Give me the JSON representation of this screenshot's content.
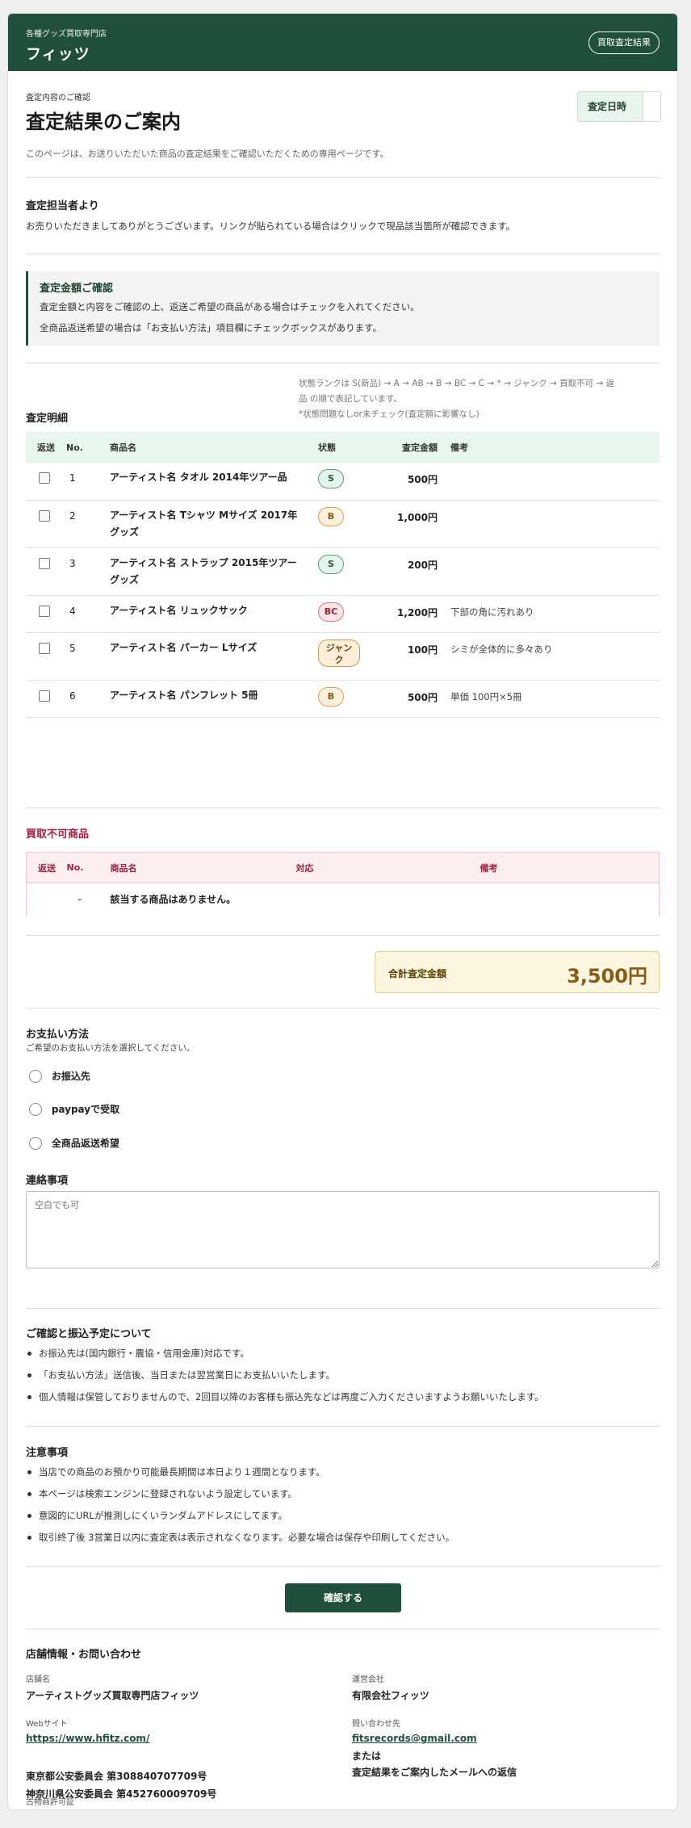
{
  "header": {
    "shop_sub": "各種グッズ買取専門店",
    "shop_name": "フィッツ",
    "result_button": "買取査定結果"
  },
  "intro": {
    "label": "査定内容のご確認",
    "title": "査定結果のご案内",
    "description": "このページは、お送りいただいた商品の査定結果をご確認いただくための専用ページです。",
    "date_label": "査定日時"
  },
  "appraiser": {
    "title": "査定担当者より",
    "message": "お売りいただきましてありがとうございます。リンクが貼られている場合はクリックで現品該当箇所が確認できます。"
  },
  "notice": {
    "title": "査定金額ご確認",
    "line1": "査定金額と内容をご確認の上、返送ご希望の商品がある場合はチェックを入れてください。",
    "line2": "全商品返送希望の場合は「お支払い方法」項目欄にチェックボックスがあります。"
  },
  "details": {
    "title": "査定明細",
    "rank_note1": "状態ランクは S(新品) → A → AB → B → BC → C → * → ジャンク → 買取不可 → 返",
    "rank_note2": "品 の順で表記しています。",
    "rank_note3": "*状態問題なしor未チェック(査定額に影響なし)",
    "columns": [
      "返送",
      "No.",
      "商品名",
      "状態",
      "査定金額",
      "備考"
    ],
    "rows": [
      {
        "no": "1",
        "name": "アーティスト名 タオル 2014年ツアー品",
        "name2": "",
        "status": "S",
        "price": "500円",
        "note": ""
      },
      {
        "no": "2",
        "name": "アーティスト名 Tシャツ Mサイズ 2017年",
        "name2": "グッズ",
        "status": "B",
        "price": "1,000円",
        "note": ""
      },
      {
        "no": "3",
        "name": "アーティスト名 ストラップ 2015年ツアー",
        "name2": "グッズ",
        "status": "S",
        "price": "200円",
        "note": ""
      },
      {
        "no": "4",
        "name": "アーティスト名 リュックサック",
        "name2": "",
        "status": "BC",
        "price": "1,200円",
        "note": "下部の角に汚れあり"
      },
      {
        "no": "5",
        "name": "アーティスト名 パーカー Lサイズ",
        "name2": "",
        "status": "ジャンク",
        "price": "100円",
        "note": "シミが全体的に多々あり"
      },
      {
        "no": "6",
        "name": "アーティスト名 パンフレット 5冊",
        "name2": "",
        "status": "B",
        "price": "500円",
        "note": "単価 100円×5冊"
      }
    ]
  },
  "rejected": {
    "title": "買取不可商品",
    "columns": [
      "返送",
      "No.",
      "商品名",
      "対応",
      "備考"
    ],
    "empty_no": "-",
    "empty_text": "該当する商品はありません。"
  },
  "total": {
    "label": "合計査定金額",
    "value": "3,500円"
  },
  "payment": {
    "title": "お支払い方法",
    "subtitle": "ご希望のお支払い方法を選択してください。",
    "options": [
      "お振込先",
      "paypayで受取",
      "全商品返送希望"
    ]
  },
  "contact_note": {
    "title": "連絡事項",
    "placeholder": "空白でも可"
  },
  "transfer": {
    "title": "ご確認と振込予定について",
    "items": [
      "お振込先は(国内銀行・農協・信用金庫)対応です。",
      "「お支払い方法」送信後、当日または翌営業日にお支払いいたします。",
      "個人情報は保管しておりませんので、2回目以降のお客様も振込先などは再度ご入力くださいますようお願いいたします。"
    ]
  },
  "cautions": {
    "title": "注意事項",
    "items": [
      "当店での商品のお預かり可能最長期間は本日より１週間となります。",
      "本ページは検索エンジンに登録されないよう設定しています。",
      "意図的にURLが推測しにくいランダムアドレスにしてます。",
      "取引終了後 3営業日以内に査定表は表示されなくなります。必要な場合は保存や印刷してください。"
    ]
  },
  "confirm_button": "確認する",
  "store_info": {
    "title": "店舗情報・お問い合わせ",
    "store_name_label": "店舗名",
    "store_name": "アーティストグッズ買取専門店フィッツ",
    "company_label": "運営会社",
    "company": "有限会社フィッツ",
    "website_label": "Webサイト",
    "website": "https://www.hfitz.com/",
    "contact_label": "問い合わせ先",
    "contact_email": "fitsrecords@gmail.com",
    "contact_or": "または",
    "contact_reply": "査定結果をご案内したメールへの返信",
    "license_label": "古物商許可証",
    "license1": "東京都公安委員会 第308840707709号",
    "license2": "神奈川県公安委員会 第452760009709号"
  },
  "colors": {
    "brand_green": "#20503b",
    "header_mint": "#e7f6ee",
    "reject_pink": "#fdeef2",
    "total_yellow": "#fdf5df"
  }
}
